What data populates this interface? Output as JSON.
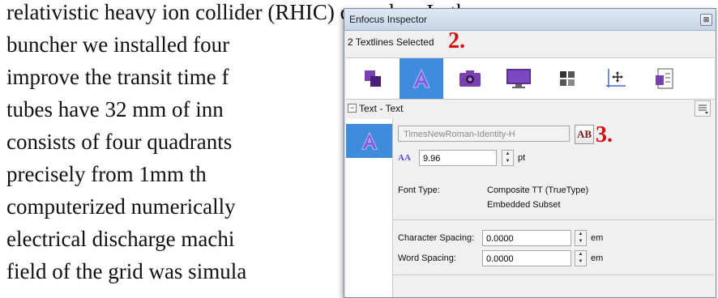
{
  "document": {
    "lines": [
      "relativistic heavy ion collider (RHIC) complex. In the",
      "buncher we installed four",
      "improve the transit time f",
      "tubes have 32 mm of inn",
      "consists of four quadrants",
      "precisely  from  1mm  th",
      "computerized numerically",
      "electrical discharge machi",
      "field of the grid was simula"
    ]
  },
  "inspector": {
    "title": "Enfocus Inspector",
    "close_symbol": "⊠",
    "status": "2 Textlines Selected",
    "annotation_2": "2.",
    "annotation_3": "3.",
    "section_title": "Text - Text",
    "collapse_symbol": "−",
    "font_name": "TimesNewRoman-Identity-H",
    "font_button_label": "AB",
    "size_icon_label": "AA",
    "font_size": "9.96",
    "font_size_unit": "pt",
    "font_type_label": "Font Type:",
    "font_type_value": "Composite TT (TrueType)",
    "font_embed_value": "Embedded Subset",
    "char_spacing_label": "Character Spacing:",
    "char_spacing_value": "0.0000",
    "char_spacing_unit": "em",
    "word_spacing_label": "Word Spacing:",
    "word_spacing_value": "0.0000",
    "word_spacing_unit": "em",
    "spinner_up": "▲",
    "spinner_down": "▼",
    "colors": {
      "accent": "#3f8bdc",
      "annotation": "#d01010",
      "text_purple": "#6b46c8"
    },
    "toolbar_icons": [
      "object-stack-icon",
      "text-icon",
      "camera-icon",
      "monitor-icon",
      "grid-icon",
      "position-axes-icon",
      "properties-icon"
    ]
  }
}
